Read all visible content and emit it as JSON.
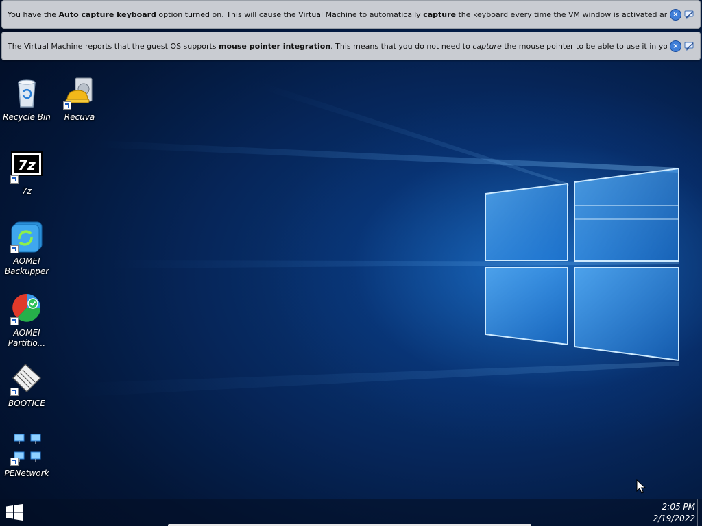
{
  "banners": [
    {
      "parts": [
        {
          "t": "You have the ",
          "s": "n"
        },
        {
          "t": "Auto capture keyboard",
          "s": "b"
        },
        {
          "t": " option turned on. This will cause the Virtual Machine to automatically ",
          "s": "n"
        },
        {
          "t": "capture",
          "s": "b"
        },
        {
          "t": " the keyboard every time the VM window is activated and make it unavailable to",
          "s": "n"
        }
      ],
      "close_icon": "close-icon",
      "hide_icon": "dont-show-again-icon"
    },
    {
      "parts": [
        {
          "t": "The Virtual Machine reports that the guest OS supports ",
          "s": "n"
        },
        {
          "t": "mouse pointer integration",
          "s": "b"
        },
        {
          "t": ". This means that you do not need to ",
          "s": "n"
        },
        {
          "t": "capture",
          "s": "i"
        },
        {
          "t": " the mouse pointer to be able to use it in your guest OS -- all mouse",
          "s": "n"
        }
      ],
      "close_icon": "close-icon",
      "hide_icon": "dont-show-again-icon"
    }
  ],
  "desktop": {
    "icons": [
      {
        "label": "Recycle Bin",
        "icon": "recycle-bin-icon"
      },
      {
        "label": "Recuva",
        "icon": "recuva-icon"
      },
      {
        "label": "7z",
        "icon": "7zip-icon"
      },
      {
        "label": "AOMEI Backupper",
        "icon": "aomei-backupper-icon"
      },
      {
        "label": "AOMEI Partitio...",
        "icon": "aomei-partition-icon"
      },
      {
        "label": "BOOTICE",
        "icon": "bootice-icon"
      },
      {
        "label": "PENetwork",
        "icon": "penetwork-icon"
      }
    ]
  },
  "taskbar": {
    "start_icon": "windows-start-icon",
    "time": "2:05 PM",
    "date": "2/19/2022"
  },
  "colors": {
    "banner_bg": "#c9ccd2",
    "desktop_glow": "#288ceb",
    "desktop_dark": "#031637"
  }
}
